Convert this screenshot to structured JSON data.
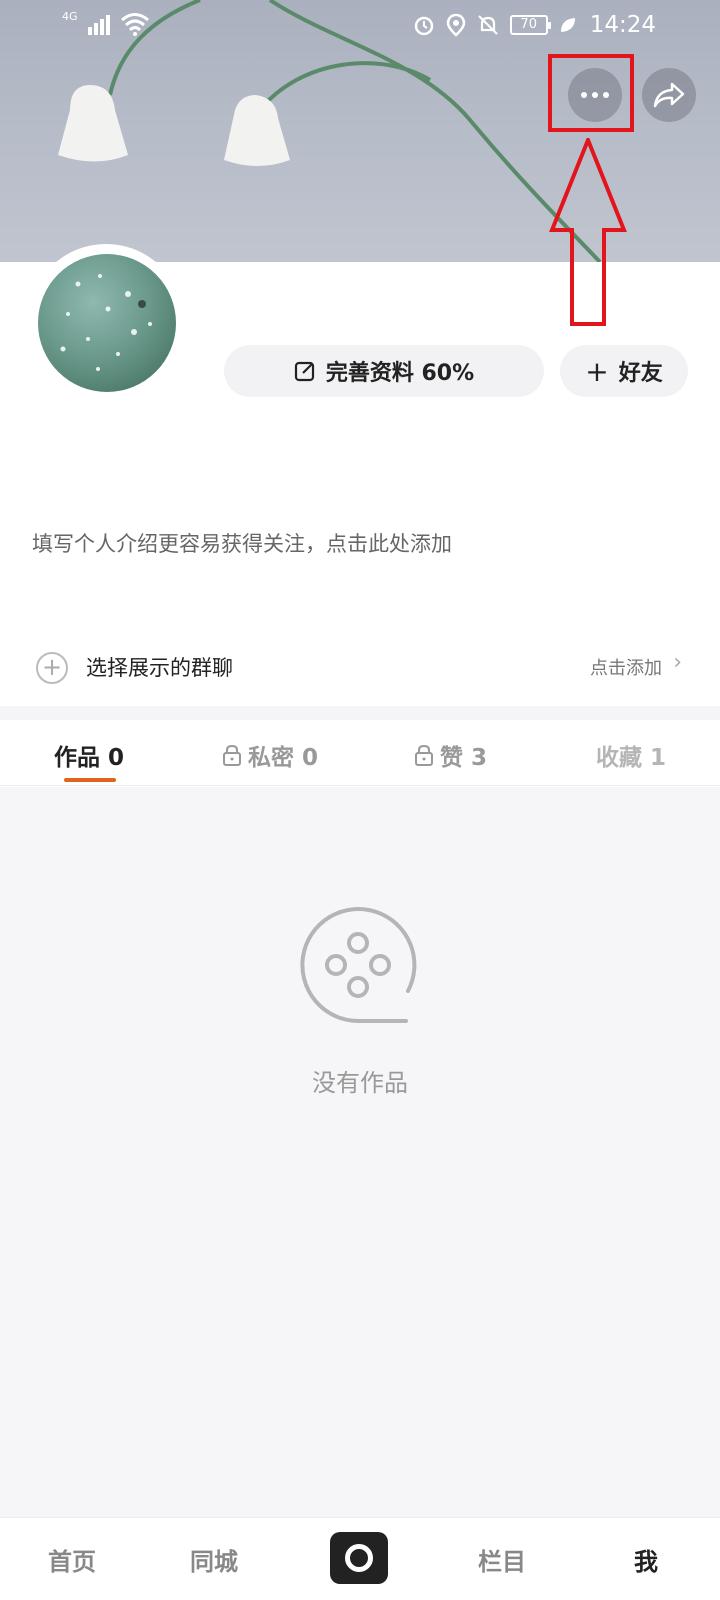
{
  "status_bar": {
    "network": "4G",
    "battery": "70",
    "time": "14:24"
  },
  "profile": {
    "edit_label": "完善资料 60%",
    "friend_label": "好友",
    "bio_placeholder": "填写个人介绍更容易获得关注，点击此处添加"
  },
  "group_chat": {
    "label": "选择展示的群聊",
    "action": "点击添加"
  },
  "tabs": [
    {
      "label": "作品 0"
    },
    {
      "label": "私密 0"
    },
    {
      "label": "赞 3"
    },
    {
      "label": "收藏 1"
    }
  ],
  "empty_state": {
    "text": "没有作品"
  },
  "bottom_nav": {
    "home": "首页",
    "city": "同城",
    "column": "栏目",
    "me": "我"
  },
  "colors": {
    "annotation_red": "#e2141c",
    "tab_underline": "#e0641e"
  },
  "icons": {
    "more": "more-dots-icon",
    "share": "share-icon",
    "edit": "edit-icon",
    "add": "plus-icon",
    "lock": "lock-icon",
    "empty": "film-reel-icon",
    "camera": "camera-icon"
  }
}
